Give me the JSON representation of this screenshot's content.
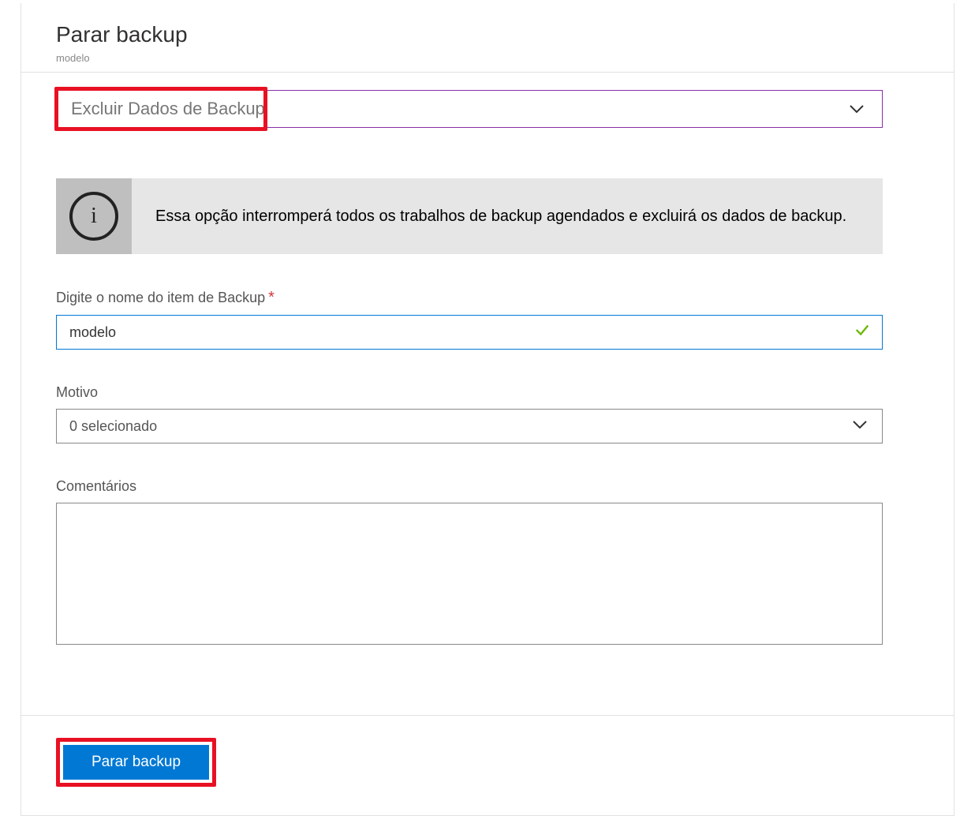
{
  "header": {
    "title": "Parar backup",
    "subtitle": "modelo"
  },
  "action_dropdown": {
    "selected_label": "Excluir Dados de Backup"
  },
  "info_bar": {
    "icon": "info",
    "message": "Essa opção interromperá todos os trabalhos de backup agendados e excluirá os dados de backup."
  },
  "fields": {
    "item_name": {
      "label": "Digite o nome do item de Backup",
      "required": true,
      "value": "modelo",
      "valid": true
    },
    "reason": {
      "label": "Motivo",
      "selected_label": "0 selecionado"
    },
    "comments": {
      "label": "Comentários",
      "value": ""
    }
  },
  "footer": {
    "submit_label": "Parar backup"
  },
  "highlights": {
    "dropdown_highlighted": true,
    "submit_highlighted": true
  }
}
